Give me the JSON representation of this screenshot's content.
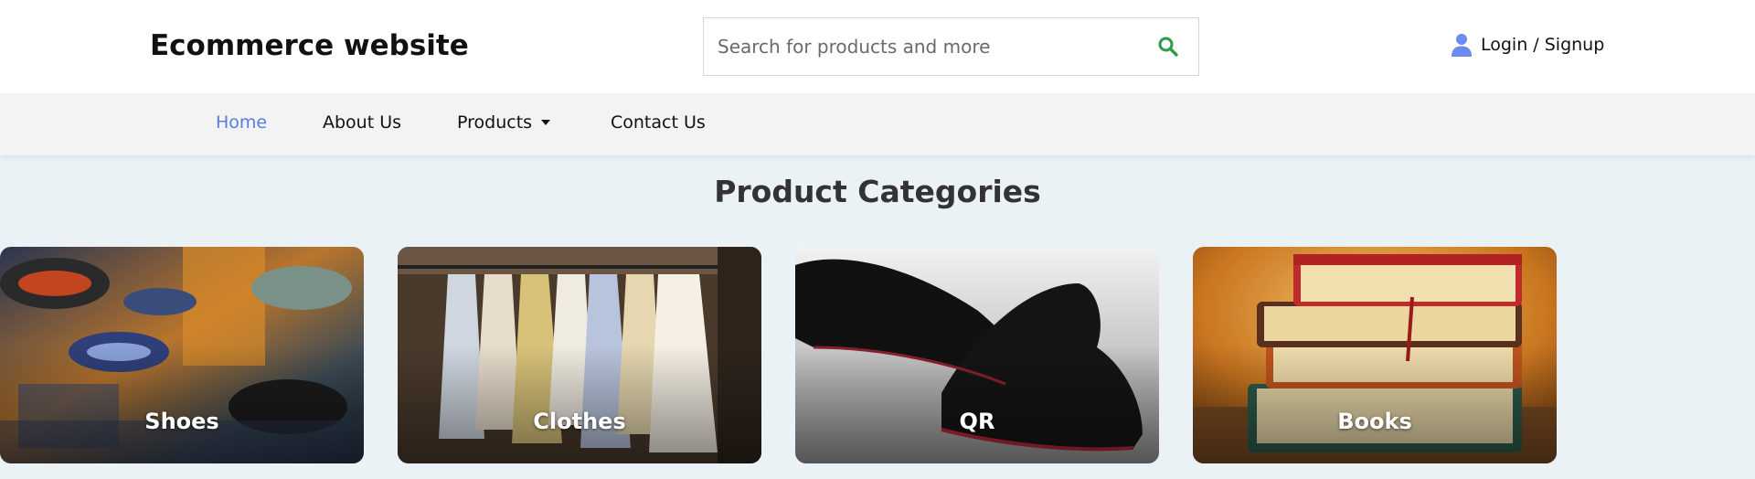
{
  "header": {
    "brand": "Ecommerce website",
    "search": {
      "placeholder": "Search for products and more",
      "value": ""
    },
    "login_label": "Login / Signup"
  },
  "nav": {
    "items": [
      {
        "label": "Home",
        "active": true
      },
      {
        "label": "About Us"
      },
      {
        "label": "Products",
        "has_dropdown": true
      },
      {
        "label": "Contact Us"
      }
    ]
  },
  "main": {
    "title": "Product Categories",
    "categories": [
      {
        "label": "Shoes"
      },
      {
        "label": "Clothes"
      },
      {
        "label": "QR"
      },
      {
        "label": "Books"
      }
    ]
  },
  "colors": {
    "accent": "#5a7be6",
    "search_icon": "#2e9a4a",
    "page_bg": "#eaf2f5",
    "nav_bg": "#f3f3f3"
  },
  "icons": {
    "search": "search-icon",
    "user": "user-icon",
    "dropdown": "caret-down-icon"
  }
}
